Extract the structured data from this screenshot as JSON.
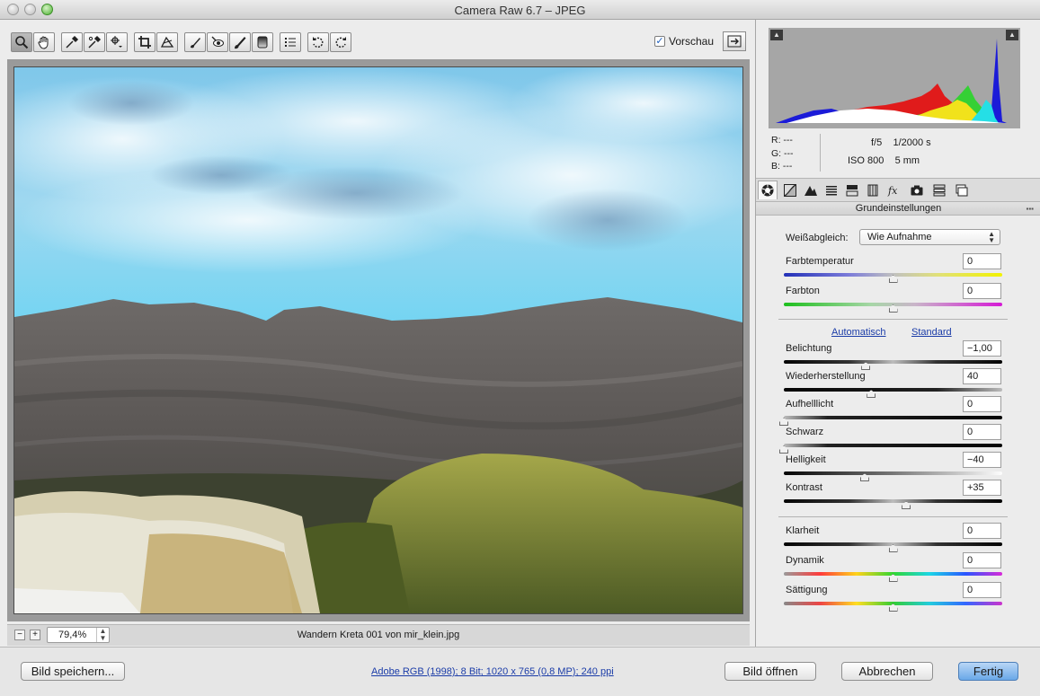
{
  "window": {
    "title": "Camera Raw 6.7 – JPEG"
  },
  "toolbar": {
    "tools": [
      "zoom-tool",
      "hand-tool",
      "white-balance-tool",
      "color-sampler-tool",
      "targeted-adjustment-tool",
      "crop-tool",
      "straighten-tool",
      "spot-removal-tool",
      "red-eye-tool",
      "adjustment-brush-tool",
      "graduated-filter-tool",
      "preferences-tool",
      "rotate-left-tool",
      "rotate-right-tool"
    ],
    "preview_label": "Vorschau",
    "preview_checked": true
  },
  "status": {
    "zoom": "79,4%",
    "filename": "Wandern Kreta 001 von mir_klein.jpg"
  },
  "histogram": {
    "colors": {
      "red": "#e01b1b",
      "green": "#35d035",
      "blue": "#1b1bd8",
      "yellow": "#f1e21b",
      "cyan": "#25dfe6"
    }
  },
  "readout": {
    "r": "R:  ---",
    "g": "G:  ---",
    "b": "B:  ---",
    "aperture": "f/5",
    "shutter": "1/2000 s",
    "iso": "ISO 800",
    "focal": "5 mm"
  },
  "panel": {
    "title": "Grundeinstellungen",
    "white_balance": {
      "label": "Weißabgleich:",
      "value": "Wie Aufnahme"
    },
    "auto_link": "Automatisch",
    "default_link": "Standard",
    "controls": [
      {
        "label": "Farbtemperatur",
        "value": "0",
        "level": 0.5
      },
      {
        "label": "Farbton",
        "value": "0",
        "level": 0.5
      },
      {
        "label": "Belichtung",
        "value": "−1,00",
        "level": 0.375
      },
      {
        "label": "Wiederherstellung",
        "value": "40",
        "level": 0.4
      },
      {
        "label": "Aufhelllicht",
        "value": "0",
        "level": 0.0
      },
      {
        "label": "Schwarz",
        "value": "0",
        "level": 0.0
      },
      {
        "label": "Helligkeit",
        "value": "−40",
        "level": 0.37
      },
      {
        "label": "Kontrast",
        "value": "+35",
        "level": 0.56
      },
      {
        "label": "Klarheit",
        "value": "0",
        "level": 0.5
      },
      {
        "label": "Dynamik",
        "value": "0",
        "level": 0.5
      },
      {
        "label": "Sättigung",
        "value": "0",
        "level": 0.5
      }
    ]
  },
  "bottom": {
    "save_label": "Bild speichern...",
    "workflow_label": "Adobe RGB (1998); 8 Bit; 1020 x 765 (0,8 MP); 240 ppi",
    "open_label": "Bild öffnen",
    "cancel_label": "Abbrechen",
    "done_label": "Fertig"
  }
}
